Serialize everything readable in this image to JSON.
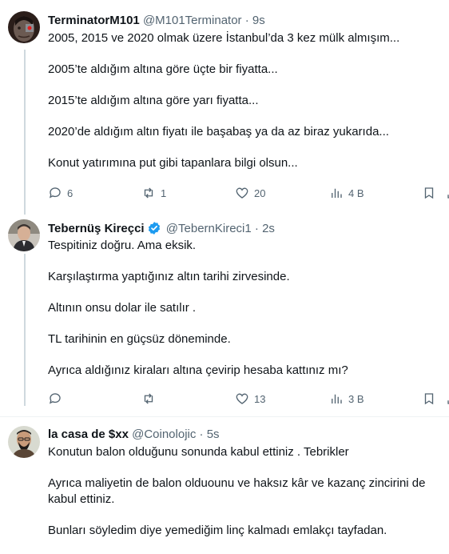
{
  "tweets": [
    {
      "name": "TerminatorM101",
      "handle": "@M101Terminator",
      "dot": "·",
      "time": "9s",
      "verified": false,
      "paragraphs": [
        "2005, 2015 ve 2020 olmak üzere İstanbul’da 3 kez mülk almışım...",
        "2005’te aldığım altına göre üçte bir fiyatta...",
        "2015’te aldığım altına göre yarı fiyatta...",
        "2020’de aldığım altın fiyatı ile başabaş ya da az biraz yukarıda...",
        "Konut yatırımına put gibi tapanlara bilgi olsun..."
      ],
      "replies": "6",
      "retweets": "1",
      "likes": "20",
      "views": "4 B"
    },
    {
      "name": "Tebernüş Kireçci",
      "handle": "@TebernKireci1",
      "dot": "·",
      "time": "2s",
      "verified": true,
      "paragraphs": [
        "Tespitiniz doğru. Ama eksik.",
        "Karşılaştırma yaptığınız altın tarihi zirvesinde.",
        "Altının onsu dolar ile satılır .",
        "TL tarihinin en güçsüz döneminde.",
        "Ayrıca aldığınız kiraları altına çevirip hesaba kattınız mı?"
      ],
      "replies": "",
      "retweets": "",
      "likes": "13",
      "views": "3 B"
    },
    {
      "name": "la casa de $xx",
      "handle": "@Coinolojic",
      "dot": "·",
      "time": "5s",
      "verified": false,
      "paragraphs": [
        "Konutun balon olduğunu sonunda kabul ettiniz . Tebrikler",
        "Ayrıca maliyetin de balon olduounu ve haksız kâr ve kazanç zincirini de kabul ettiniz.",
        "Bunları söyledim diye yemediğim linç kalmadı emlakçı tayfadan."
      ]
    }
  ],
  "icons": {
    "reply": "comment-icon",
    "retweet": "retweet-icon",
    "like": "heart-icon",
    "views": "analytics-icon",
    "bookmark": "bookmark-icon",
    "share": "share-icon"
  },
  "colors": {
    "text": "#0f1419",
    "secondary": "#536471",
    "verified": "#1d9bf0",
    "thread_line": "#cfd9de"
  }
}
